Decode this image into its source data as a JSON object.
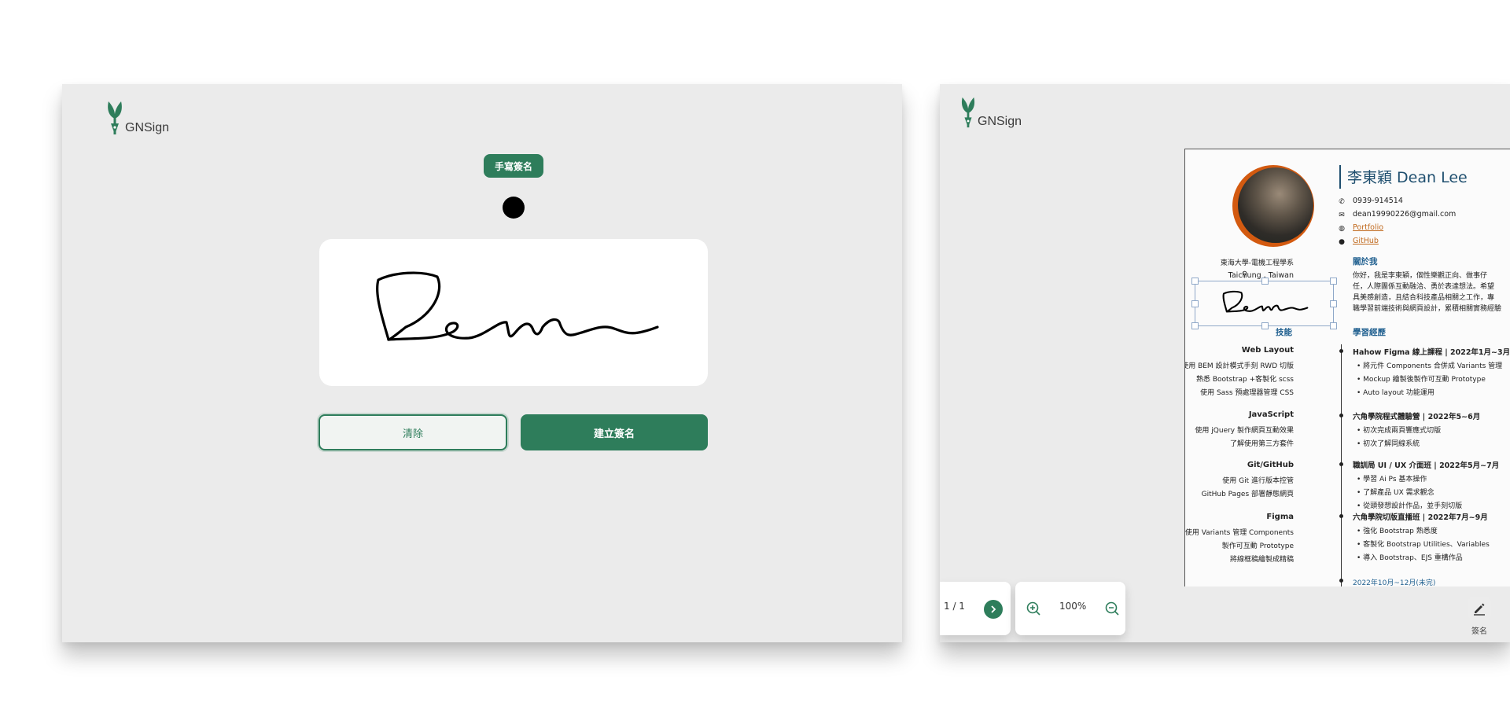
{
  "brand": {
    "name": "GNSign",
    "color": "#2e7d5b"
  },
  "signature_panel": {
    "mode_label": "手寫簽名",
    "pen_color": "#000000",
    "clear_label": "清除",
    "create_label": "建立簽名"
  },
  "resume": {
    "name": "李東穎 Dean Lee",
    "phone": "0939-914514",
    "email": "dean19990226@gmail.com",
    "portfolio": "Portfolio",
    "github": "GitHub",
    "school": "東海大學-電機工程學系",
    "location": "Taichung , Taiwan",
    "about_title": "關於我",
    "about_lines": [
      "你好，我是李東穎，個性樂觀正向、做事仔",
      "任，人際團係互動融洽、勇於表達想法。希望",
      "具美感創造，且結合科技產品相關之工作，專",
      "職學習前端技術與網頁設計，累積相關實務經驗"
    ],
    "skills_title": "技能",
    "skills": [
      {
        "name": "Web Layout",
        "items": [
          "使用 BEM 設計模式手刻 RWD 切版",
          "熟悉 Bootstrap +客製化 scss",
          "使用 Sass 預處理器管理 CSS"
        ]
      },
      {
        "name": "JavaScript",
        "items": [
          "使用 jQuery 製作網頁互動效果",
          "了解使用第三方套件"
        ]
      },
      {
        "name": "Git/GitHub",
        "items": [
          "使用 Git 進行版本控管",
          "GitHub Pages 部署靜態網頁"
        ]
      },
      {
        "name": "Figma",
        "items": [
          "使用 Variants 管理 Components",
          "製作可互動 Prototype",
          "將線框稿繪製成精稿"
        ]
      }
    ],
    "exp_title": "學習經歷",
    "experience": [
      {
        "title": "Hahow Figma 線上課程 | 2022年1月~3月",
        "items": [
          "將元件 Components 合併成 Variants 管理",
          "Mockup 繪製後製作可互動 Prototype",
          "Auto layout 功能運用"
        ]
      },
      {
        "title": "六角學院程式體驗營 | 2022年5~6月",
        "items": [
          "初次完成兩頁響應式切版",
          "初次了解同線系統"
        ]
      },
      {
        "title": "職訓局 UI / UX 介面班 | 2022年5月~7月",
        "items": [
          "學習 Ai Ps 基本操作",
          "了解產品 UX 需求觀念",
          "從頭發想設計作品，並手刻切版"
        ]
      },
      {
        "title": "六角學院切版直播班 | 2022年7月~9月",
        "items": [
          "強化 Bootstrap 熟悉度",
          "客製化 Bootstrap Utilities、Variables",
          "導入 Bootstrap、EJS 重構作品"
        ]
      }
    ],
    "next_partial": "2022年10月~12月(未完)"
  },
  "viewer": {
    "page_indicator": "1 / 1",
    "zoom_level": "100%",
    "sign_label": "簽名"
  }
}
